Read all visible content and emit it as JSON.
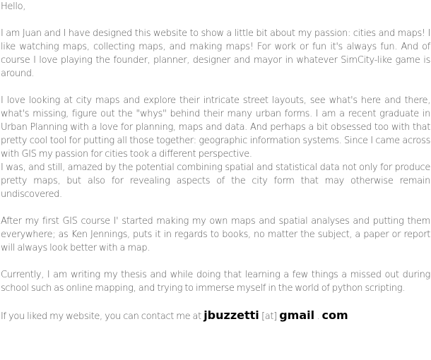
{
  "greeting": "Hello,",
  "paragraphs": {
    "intro": "I am Juan and I have designed this website to show a little bit about my  passion: cities and maps! I like watching maps, collecting maps, and making maps! For work or fun it's always fun. And of course I love playing the founder, planner, designer and mayor in whatever SimCity-like game is around.",
    "love_maps": "I love looking at city maps and explore their intricate street layouts, see what's here and there, what's missing, figure out the \"whys\" behind their many urban forms. I am a recent graduate in Urban Planning with a love for planning, maps and data. And perhaps a bit obsessed too with that pretty cool tool for putting all those together: geographic information systems. Since I came across with GIS my passion for cities took a different perspective.",
    "amazed": "I was, and still, amazed by the potential combining spatial and statistical data not only for produce pretty maps, but also for revealing aspects of the city form that may otherwise remain undiscovered.",
    "first_gis": "After my first GIS course I' started making my own maps and spatial analyses and putting them everywhere; as Ken Jennings, puts it in regards to books, no matter the subject, a paper or report will always look better with a map.",
    "currently": "Currently, I am writing my thesis and while doing that learning a few things a missed out during school such as online mapping, and trying to immerse myself in the world of python scripting."
  },
  "contact": {
    "prefix": "If you liked my website, you can contact me at ",
    "user": "jbuzzetti",
    "at": "[at]",
    "domain": "gmail",
    "dot": ".",
    "tld": "com"
  }
}
